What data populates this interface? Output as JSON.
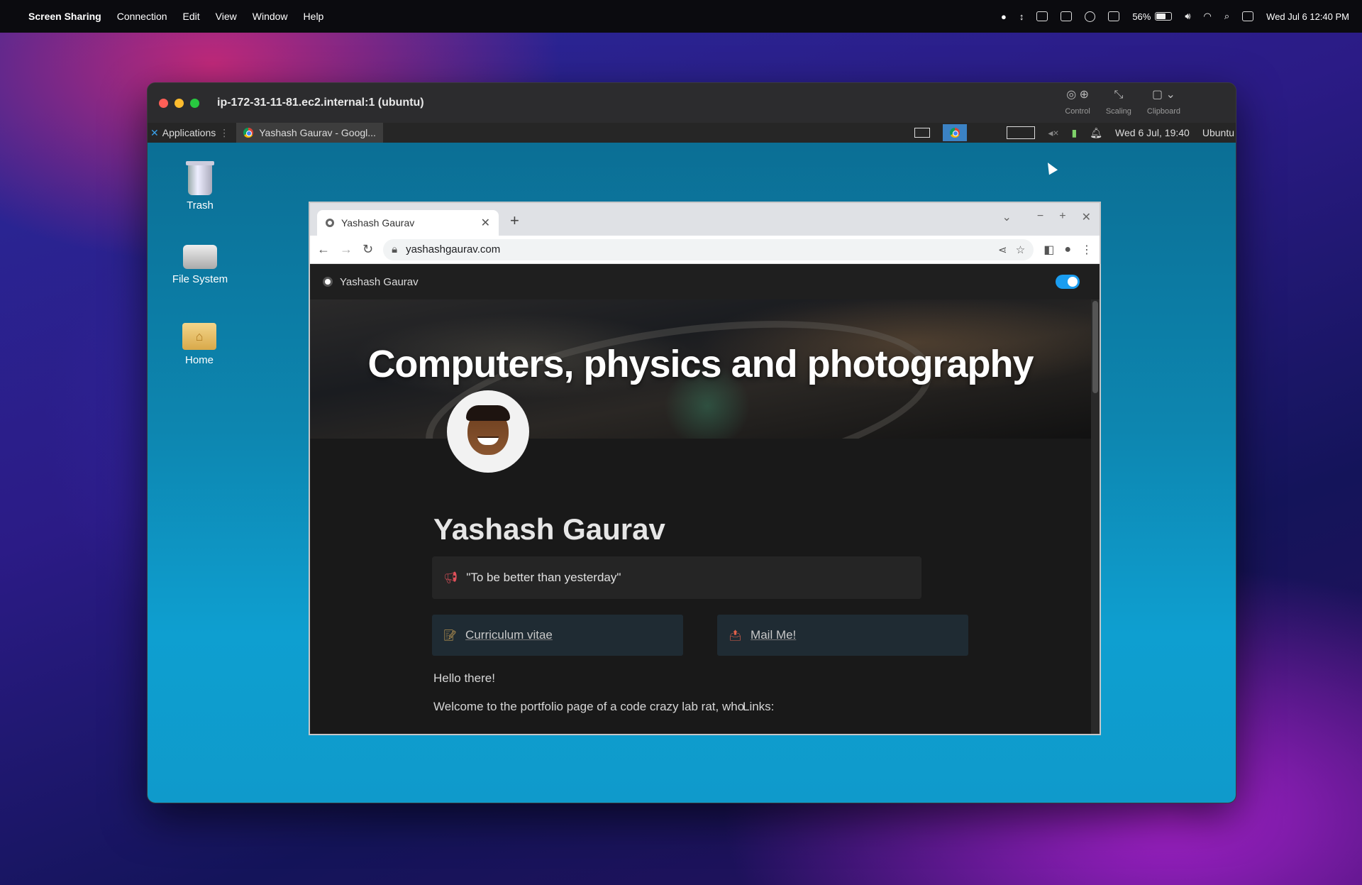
{
  "mac_menubar": {
    "app": "Screen Sharing",
    "items": [
      "Connection",
      "Edit",
      "View",
      "Window",
      "Help"
    ],
    "battery": "56%",
    "datetime": "Wed Jul 6  12:40 PM"
  },
  "screen_sharing": {
    "window_title": "ip-172-31-11-81.ec2.internal:1 (ubuntu)",
    "tools": {
      "control": "Control",
      "scaling": "Scaling",
      "clipboard": "Clipboard"
    }
  },
  "xfce_panel": {
    "applications": "Applications",
    "task": "Yashash Gaurav - Googl...",
    "datetime": "Wed  6 Jul, 19:40",
    "user": "Ubuntu"
  },
  "desktop_icons": {
    "trash": "Trash",
    "filesystem": "File System",
    "home": "Home"
  },
  "browser": {
    "tab_title": "Yashash Gaurav",
    "url": "yashashgaurav.com",
    "site_header": "Yashash Gaurav",
    "cover_title": "Computers, physics and photography",
    "page_title": "Yashash Gaurav",
    "quote": "\"To be better than yesterday\"",
    "links": {
      "cv": "Curriculum vitae",
      "mail": "Mail Me!"
    },
    "greeting": "Hello there!",
    "welcome": "Welcome to the portfolio page of a code crazy lab rat, who",
    "links_label": "Links:"
  },
  "colors": {
    "accent_toggle": "#1a9df0",
    "desktop_blue": "#0d86b0"
  }
}
